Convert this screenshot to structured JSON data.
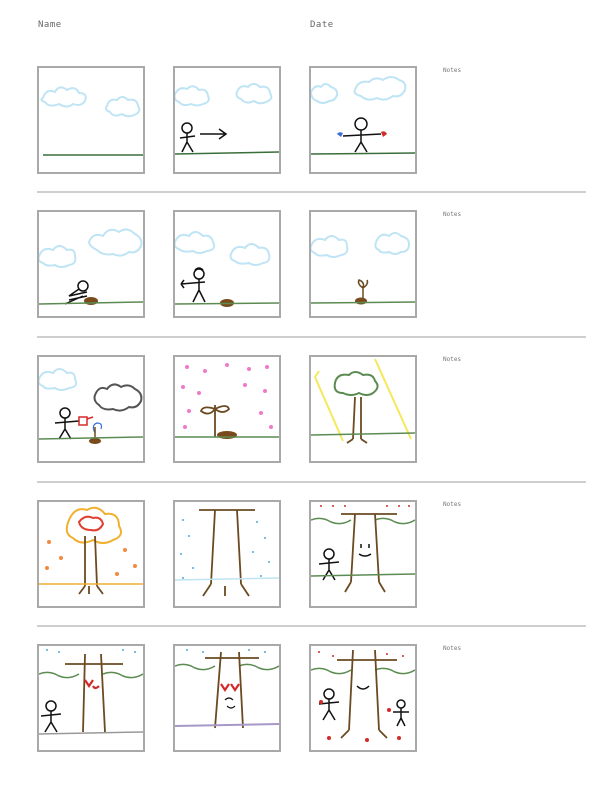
{
  "header": {
    "name_label": "Name",
    "date_label": "Date"
  },
  "rows": [
    {
      "notes_label": "Notes"
    },
    {
      "notes_label": "Notes"
    },
    {
      "notes_label": "Notes"
    },
    {
      "notes_label": "Notes"
    },
    {
      "notes_label": "Notes"
    }
  ],
  "colors": {
    "panel_border": "#a9a9a9",
    "divider": "#cfcfcf",
    "sky": "#bfe4f4",
    "ground": "#3a6e3a",
    "trunk": "#6b4a21",
    "leaf_pink": "#f07ac8"
  }
}
